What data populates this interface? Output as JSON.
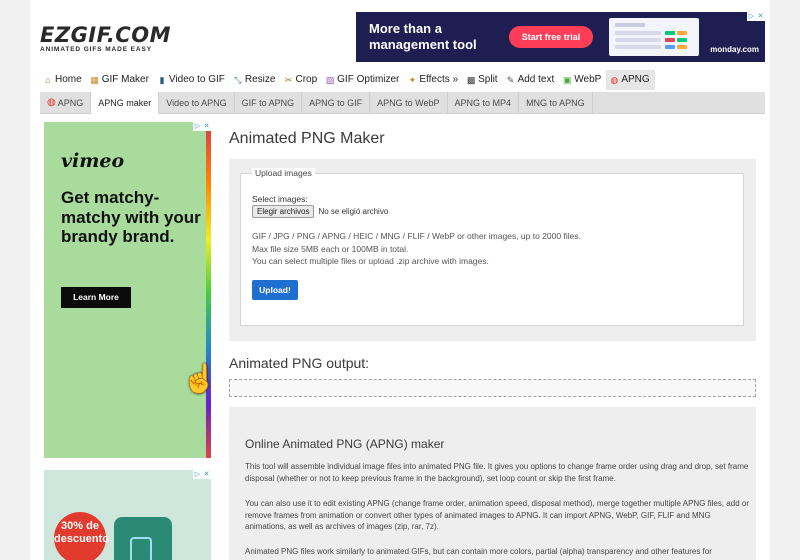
{
  "header": {
    "logo_main": "EZGIF.COM",
    "logo_tag": "ANIMATED GIFS MADE EASY"
  },
  "top_ad": {
    "headline": "More than a management tool",
    "button": "Start free trial",
    "brand": "monday.com",
    "accent": "#ff3d57"
  },
  "nav_main": [
    {
      "label": "Home",
      "icon": "home-icon",
      "glyph": "⌂"
    },
    {
      "label": "GIF Maker",
      "icon": "gif-maker-icon",
      "glyph": "▦"
    },
    {
      "label": "Video to GIF",
      "icon": "video-icon",
      "glyph": "▮"
    },
    {
      "label": "Resize",
      "icon": "resize-icon",
      "glyph": "⤡"
    },
    {
      "label": "Crop",
      "icon": "crop-icon",
      "glyph": "✂"
    },
    {
      "label": "GIF Optimizer",
      "icon": "optimizer-icon",
      "glyph": "▧"
    },
    {
      "label": "Effects »",
      "icon": "effects-icon",
      "glyph": "✦"
    },
    {
      "label": "Split",
      "icon": "split-icon",
      "glyph": "▩"
    },
    {
      "label": "Add text",
      "icon": "add-text-icon",
      "glyph": "✎"
    },
    {
      "label": "WebP",
      "icon": "webp-icon",
      "glyph": "▣"
    },
    {
      "label": "APNG",
      "icon": "apng-icon",
      "glyph": "◍"
    }
  ],
  "nav_sub": [
    {
      "label": "APNG",
      "icon": true
    },
    {
      "label": "APNG maker",
      "active": true
    },
    {
      "label": "Video to APNG"
    },
    {
      "label": "GIF to APNG"
    },
    {
      "label": "APNG to GIF"
    },
    {
      "label": "APNG to WebP"
    },
    {
      "label": "APNG to MP4"
    },
    {
      "label": "MNG to APNG"
    }
  ],
  "side_ad": {
    "brand": "vimeo",
    "copy": "Get matchy-matchy with your brandy brand.",
    "cta": "Learn More"
  },
  "side_ad2": {
    "badge": "30% de descuento"
  },
  "main": {
    "title": "Animated PNG Maker",
    "upload": {
      "legend": "Upload images",
      "select_label": "Select images:",
      "file_button": "Elegir archivos",
      "file_status": "No se eligió archivo",
      "help_1": "GIF / JPG / PNG / APNG / HEIC / MNG / FLIF / WebP or other images, up to 2000 files.",
      "help_2": "Max file size 5MB each or 100MB in total.",
      "help_3": "You can select multiple files or upload .zip archive with images.",
      "button": "Upload!",
      "button_color": "#1f6fd1"
    },
    "output_title": "Animated PNG output:",
    "info": {
      "heading": "Online Animated PNG (APNG) maker",
      "p1": "This tool will assemble individual image files into animated PNG file. It gives you options to change frame order using drag and drop, set frame disposal (whether or not to keep previous frame in the background), set loop count or skip the first frame.",
      "p2": "You can also use it to edit existing APNG (change frame order, animation speed, disposal method), merge together multiple APNG files, add or remove frames from animation or convert other types of animated images to APNG. It can import APNG, WebP, GIF, FLIF and MNG animations, as well as archives of images (zip, rar, 7z).",
      "p3": "Animated PNG files work similarly to animated GIFs, but can contain more colors, partial (alpha) transparency and other features for"
    }
  }
}
